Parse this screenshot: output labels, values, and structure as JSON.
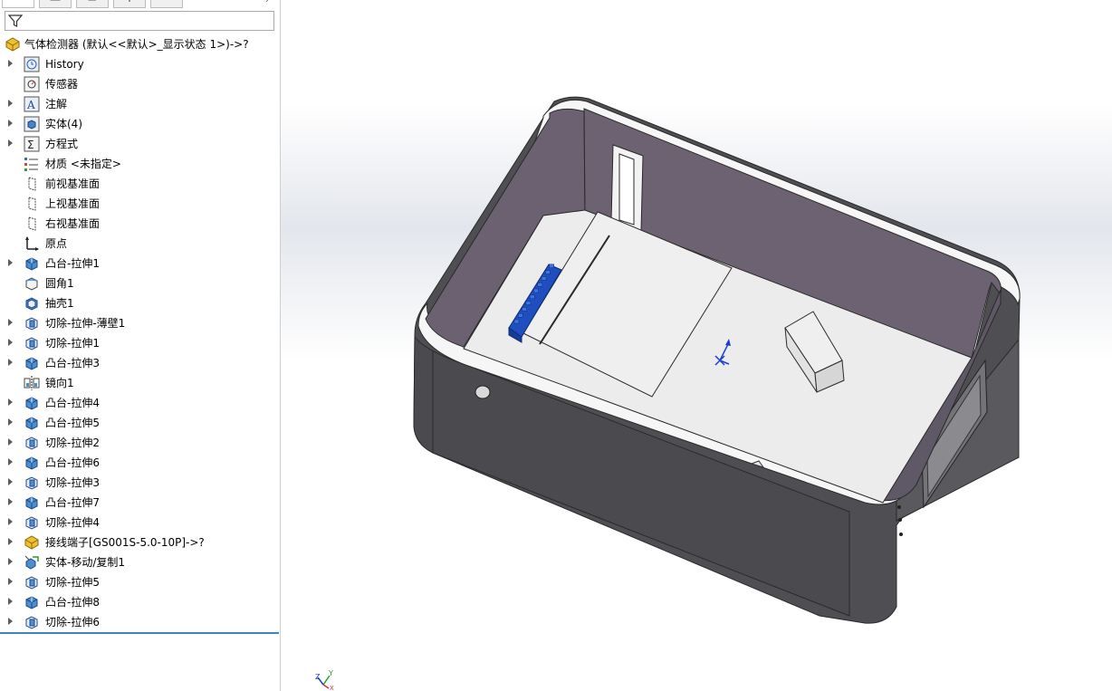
{
  "feature_tree": {
    "root": {
      "label": "气体检测器  (默认<<默认>_显示状态 1>)->?",
      "icon": "part-icon"
    },
    "items": [
      {
        "label": "History",
        "icon": "history-icon",
        "expandable": true
      },
      {
        "label": "传感器",
        "icon": "sensor-icon",
        "expandable": false
      },
      {
        "label": "注解",
        "icon": "annotation-icon",
        "expandable": true
      },
      {
        "label": "实体(4)",
        "icon": "solid-bodies-icon",
        "expandable": true
      },
      {
        "label": "方程式",
        "icon": "equations-icon",
        "expandable": true
      },
      {
        "label": "材质 <未指定>",
        "icon": "material-icon",
        "expandable": false
      },
      {
        "label": "前视基准面",
        "icon": "plane-icon",
        "expandable": false
      },
      {
        "label": "上视基准面",
        "icon": "plane-icon",
        "expandable": false
      },
      {
        "label": "右视基准面",
        "icon": "plane-icon",
        "expandable": false
      },
      {
        "label": "原点",
        "icon": "origin-icon",
        "expandable": false
      },
      {
        "label": "凸台-拉伸1",
        "icon": "boss-extrude-icon",
        "expandable": true
      },
      {
        "label": "圆角1",
        "icon": "fillet-icon",
        "expandable": false
      },
      {
        "label": "抽壳1",
        "icon": "shell-icon",
        "expandable": false
      },
      {
        "label": "切除-拉伸-薄壁1",
        "icon": "cut-extrude-icon",
        "expandable": true
      },
      {
        "label": "切除-拉伸1",
        "icon": "cut-extrude-icon",
        "expandable": true
      },
      {
        "label": "凸台-拉伸3",
        "icon": "boss-extrude-icon",
        "expandable": true
      },
      {
        "label": "镜向1",
        "icon": "mirror-icon",
        "expandable": false
      },
      {
        "label": "凸台-拉伸4",
        "icon": "boss-extrude-icon",
        "expandable": true
      },
      {
        "label": "凸台-拉伸5",
        "icon": "boss-extrude-icon",
        "expandable": true
      },
      {
        "label": "切除-拉伸2",
        "icon": "cut-extrude-icon",
        "expandable": true
      },
      {
        "label": "凸台-拉伸6",
        "icon": "boss-extrude-icon",
        "expandable": true
      },
      {
        "label": "切除-拉伸3",
        "icon": "cut-extrude-icon",
        "expandable": true
      },
      {
        "label": "凸台-拉伸7",
        "icon": "boss-extrude-icon",
        "expandable": true
      },
      {
        "label": "切除-拉伸4",
        "icon": "cut-extrude-icon",
        "expandable": true
      },
      {
        "label": "接线端子[GS001S-5.0-10P]->?",
        "icon": "derived-part-icon",
        "expandable": true
      },
      {
        "label": "实体-移动/复制1",
        "icon": "move-copy-icon",
        "expandable": true
      },
      {
        "label": "切除-拉伸5",
        "icon": "cut-extrude-icon",
        "expandable": true
      },
      {
        "label": "凸台-拉伸8",
        "icon": "boss-extrude-icon",
        "expandable": true
      },
      {
        "label": "切除-拉伸6",
        "icon": "cut-extrude-icon",
        "expandable": true
      }
    ]
  },
  "manager_tabs": [
    {
      "icon": "feature-manager-icon"
    },
    {
      "icon": "property-manager-icon"
    },
    {
      "icon": "configuration-manager-icon"
    },
    {
      "icon": "dimxpert-manager-icon"
    },
    {
      "icon": "display-manager-icon"
    }
  ],
  "triad": {
    "x": "X",
    "y": "Y",
    "z": "Z"
  },
  "colors": {
    "model_wall_dark": "#4d4d51",
    "model_wall_inner": "#6d6272",
    "model_floor": "#e9e9ea",
    "terminal_blue": "#1f4fbf",
    "selection_line": "#3c84c8"
  }
}
